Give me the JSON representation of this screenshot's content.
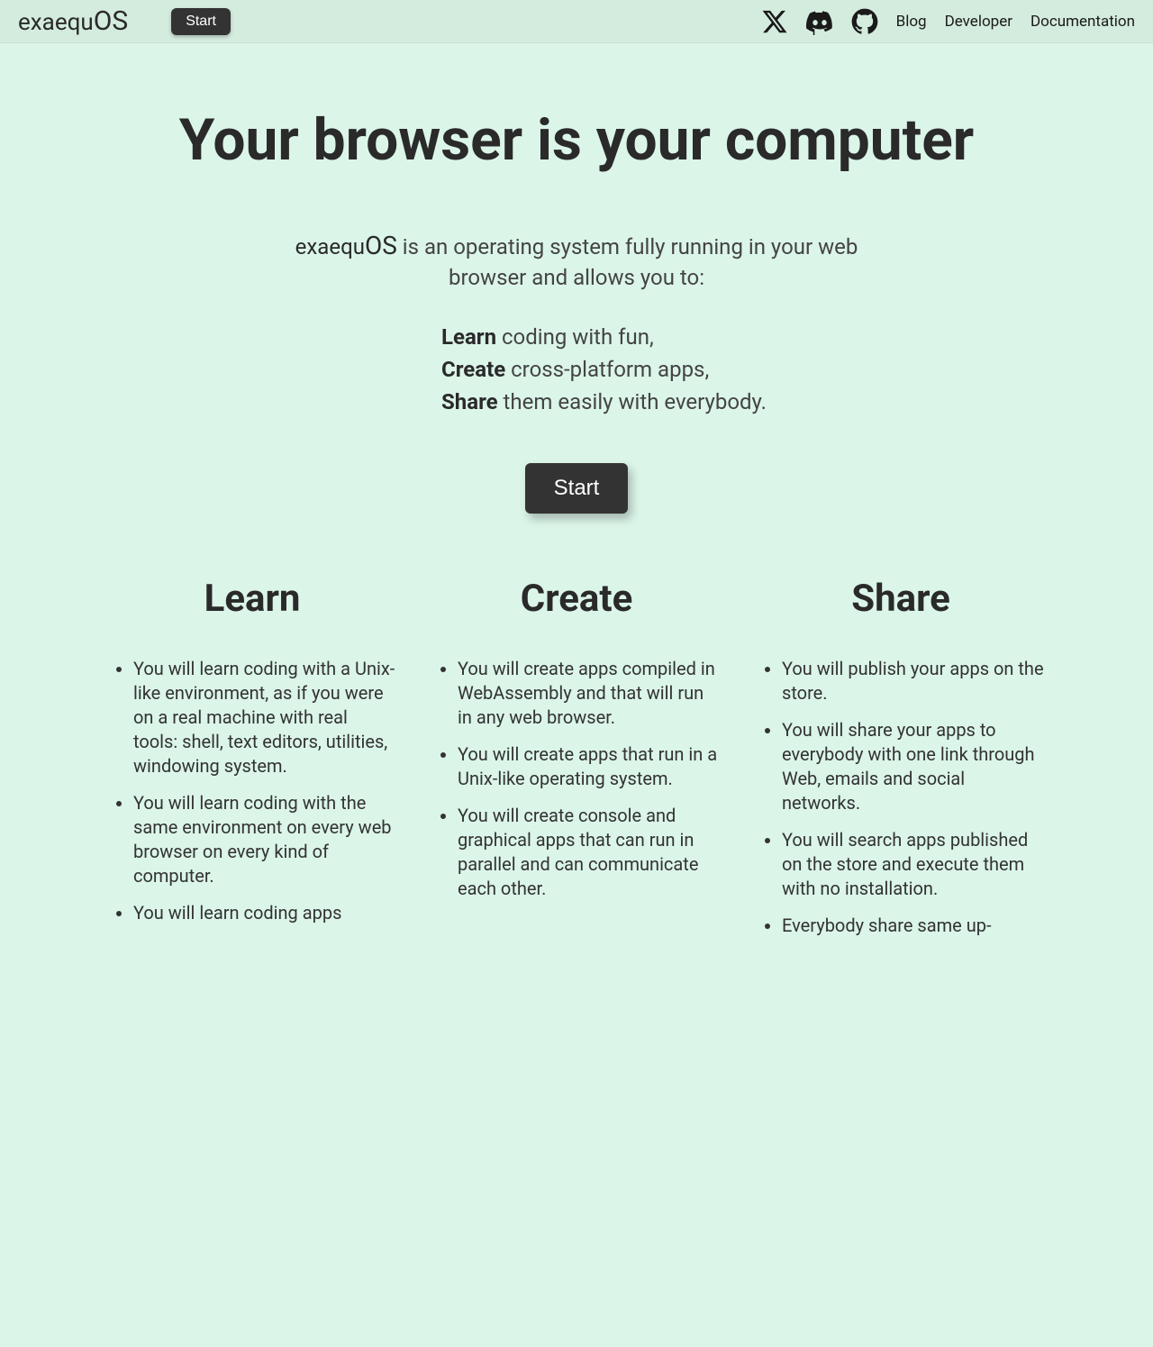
{
  "header": {
    "logo_prefix": "exaequ",
    "logo_suffix": "OS",
    "start_label": "Start",
    "nav": {
      "blog": "Blog",
      "developer": "Developer",
      "documentation": "Documentation"
    }
  },
  "hero": {
    "title": "Your browser is your computer",
    "intro_brand_prefix": "exaequ",
    "intro_brand_suffix": "OS",
    "intro_rest": " is an operating system fully running in your web browser and allows you to:",
    "features": [
      {
        "bold": "Learn",
        "rest": " coding with fun,"
      },
      {
        "bold": "Create",
        "rest": " cross-platform apps,"
      },
      {
        "bold": "Share",
        "rest": " them easily with everybody."
      }
    ],
    "start_label": "Start"
  },
  "columns": {
    "learn": {
      "title": "Learn",
      "items": [
        "You will learn coding with a Unix-like environment, as if you were on a real machine with real tools: shell, text editors, utilities, windowing system.",
        "You will learn coding with the same environment on every web browser on every kind of computer.",
        "You will learn coding apps"
      ]
    },
    "create": {
      "title": "Create",
      "items": [
        "You will create apps compiled in WebAssembly and that will run in any web browser.",
        "You will create apps that run in a Unix-like operating system.",
        "You will create console and graphical apps that can run in parallel and can communicate each other."
      ]
    },
    "share": {
      "title": "Share",
      "items": [
        "You will publish your apps on the store.",
        "You will share your apps to everybody with one link through Web, emails and social networks.",
        "You will search apps published on the store and execute them with no installation.",
        "Everybody share same up-"
      ]
    }
  }
}
